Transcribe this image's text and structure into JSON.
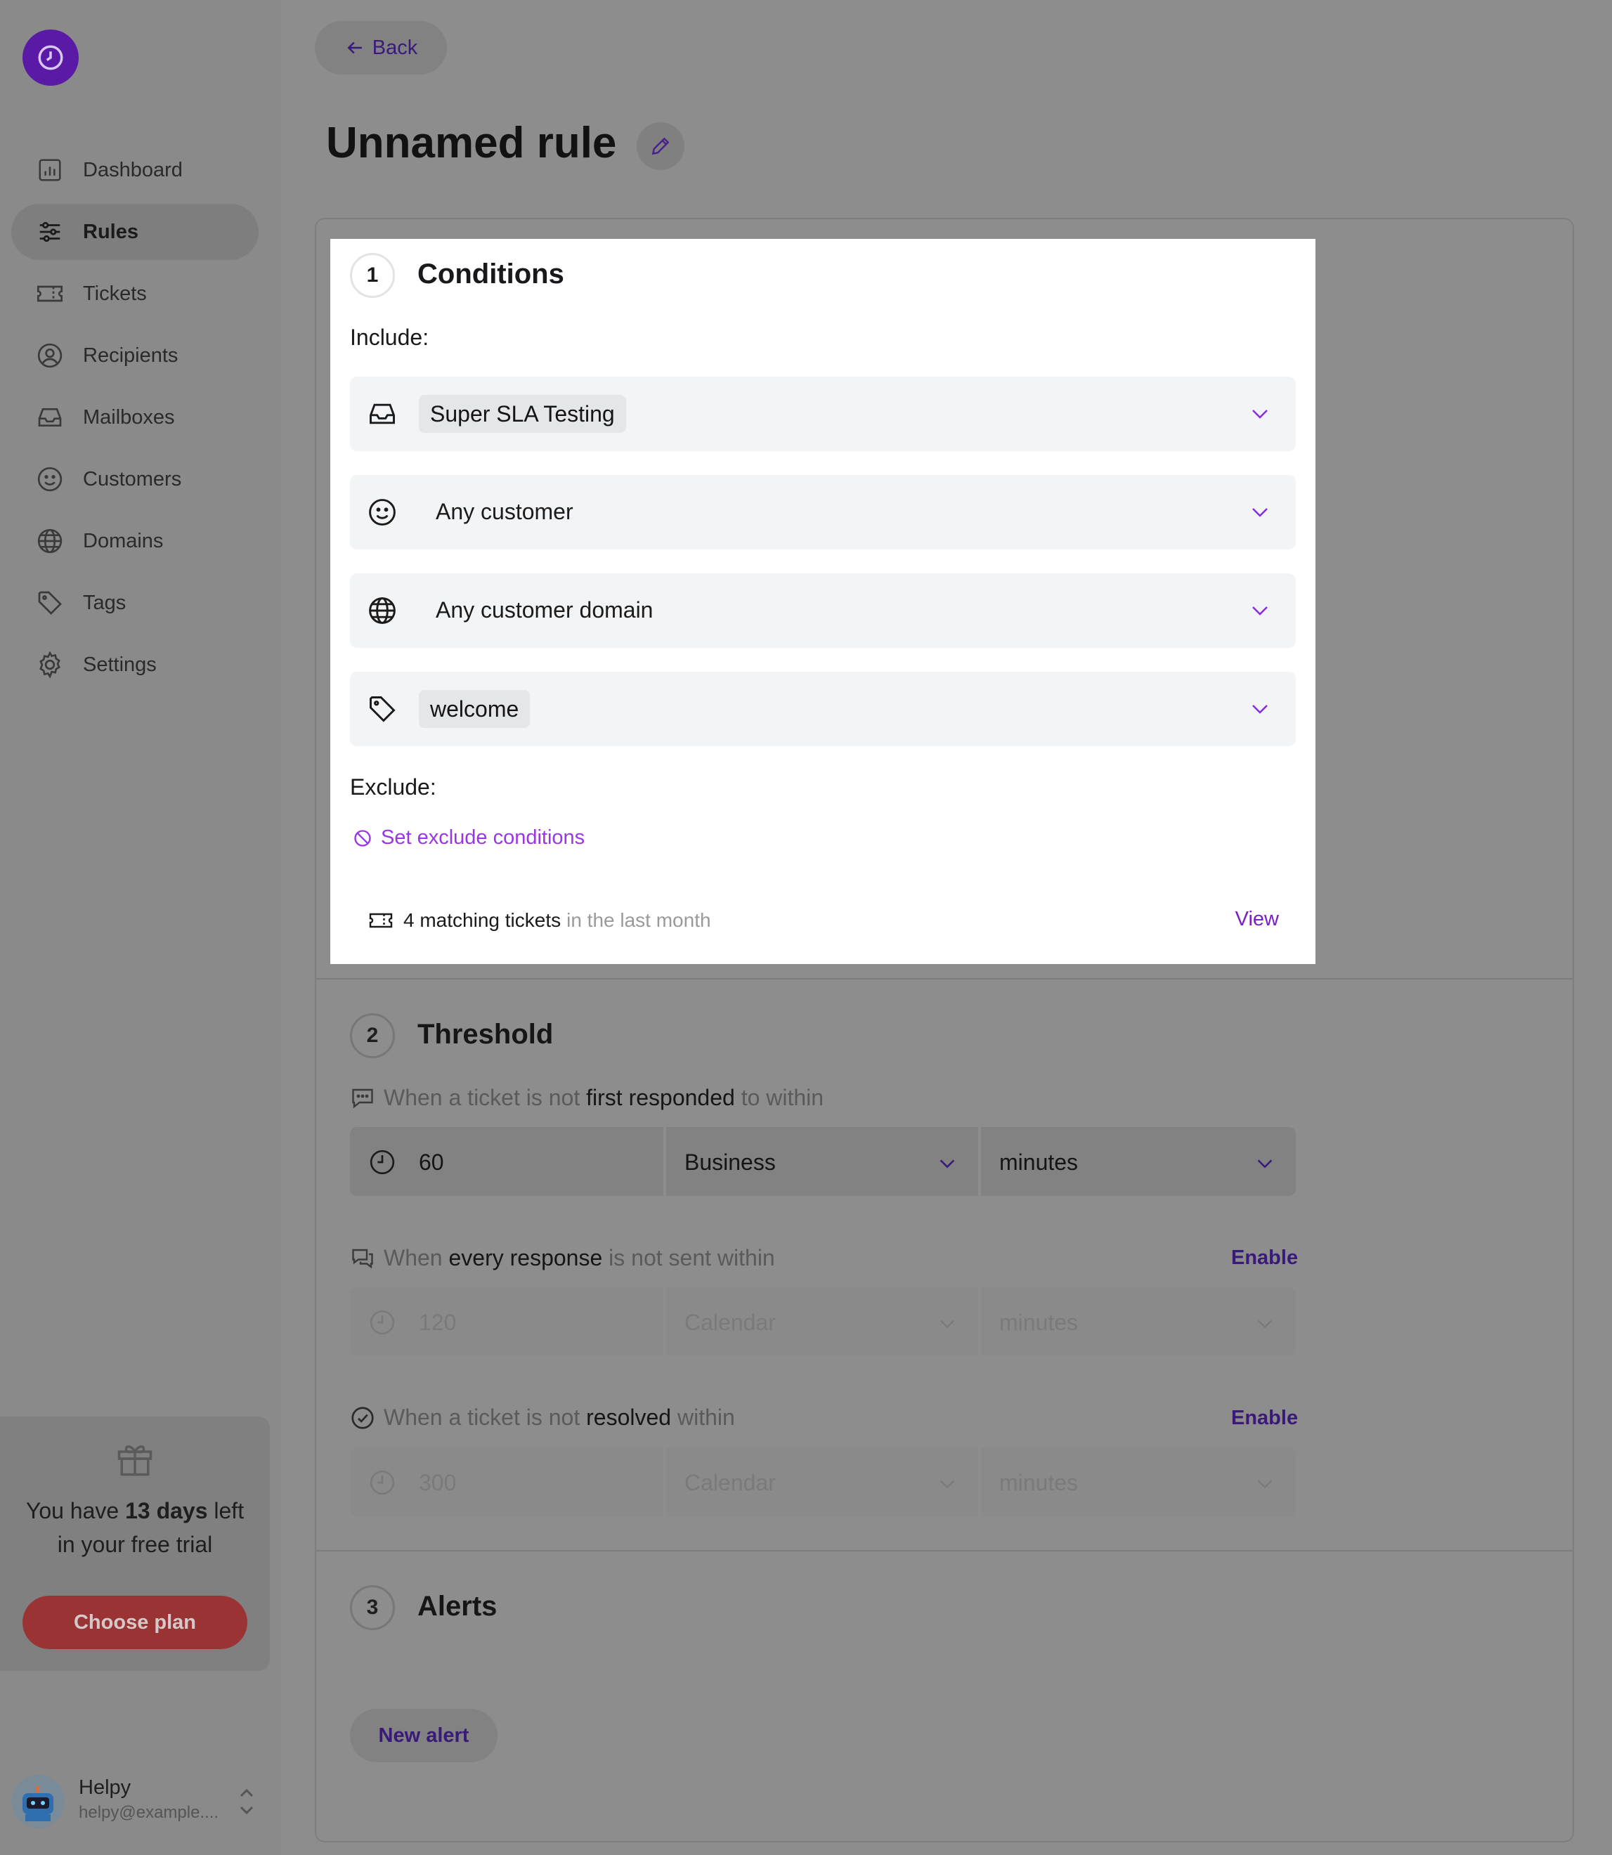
{
  "sidebar": {
    "nav": [
      {
        "label": "Dashboard",
        "icon": "chart-icon"
      },
      {
        "label": "Rules",
        "icon": "sliders-icon",
        "active": true
      },
      {
        "label": "Tickets",
        "icon": "ticket-icon"
      },
      {
        "label": "Recipients",
        "icon": "user-circle-icon"
      },
      {
        "label": "Mailboxes",
        "icon": "inbox-icon"
      },
      {
        "label": "Customers",
        "icon": "smiley-icon"
      },
      {
        "label": "Domains",
        "icon": "globe-icon"
      },
      {
        "label": "Tags",
        "icon": "tag-icon"
      },
      {
        "label": "Settings",
        "icon": "gear-icon"
      }
    ],
    "trial": {
      "prefix": "You have ",
      "days": "13 days",
      "suffix": " left",
      "line2": "in your free trial",
      "button": "Choose plan"
    },
    "user": {
      "name": "Helpy",
      "email": "helpy@example...."
    }
  },
  "header": {
    "back": "Back",
    "title": "Unnamed rule"
  },
  "conditions": {
    "step": "1",
    "title": "Conditions",
    "include_label": "Include:",
    "rows": [
      {
        "value": "Super SLA Testing",
        "chip": true
      },
      {
        "value": "Any customer",
        "chip": false
      },
      {
        "value": "Any customer domain",
        "chip": false
      },
      {
        "value": "welcome",
        "chip": true
      }
    ],
    "exclude_label": "Exclude:",
    "exclude_link": "Set exclude conditions",
    "match_count": "4 matching tickets",
    "match_period": "in the last month",
    "view": "View"
  },
  "threshold": {
    "step": "2",
    "title": "Threshold",
    "first": {
      "pre": "When a ticket is not ",
      "bold": "first responded",
      "post": " to within",
      "amount": "60",
      "calendar": "Business",
      "unit": "minutes"
    },
    "every": {
      "pre": "When ",
      "bold": "every response",
      "post": " is not sent within",
      "enable": "Enable",
      "amount": "120",
      "calendar": "Calendar",
      "unit": "minutes"
    },
    "resolved": {
      "pre": "When a ticket is not ",
      "bold": "resolved",
      "post": " within",
      "enable": "Enable",
      "amount": "300",
      "calendar": "Calendar",
      "unit": "minutes"
    }
  },
  "alerts": {
    "step": "3",
    "title": "Alerts",
    "new_alert": "New alert"
  },
  "colors": {
    "accent": "#9b35e5",
    "link": "#7a20c8",
    "brand": "#5b1aa6",
    "cta": "#9a3434"
  }
}
